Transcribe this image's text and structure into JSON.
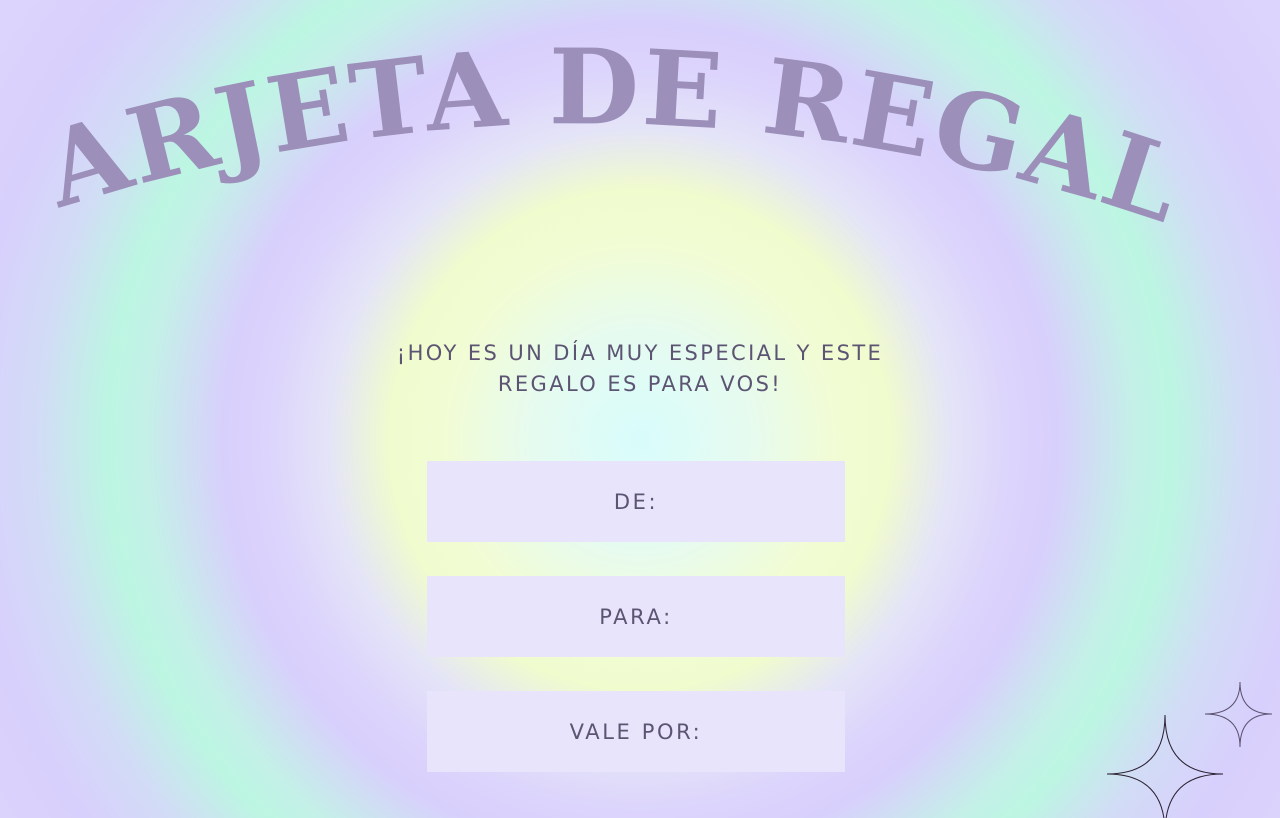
{
  "card": {
    "title": "TARJETA DE REGALO",
    "subtitle_line1": "¡HOY ES UN DÍA MUY ESPECIAL Y ESTE",
    "subtitle_line2": "REGALO ES PARA VOS!",
    "fields": {
      "from_label": "DE:",
      "to_label": "PARA:",
      "value_label": "VALE POR:"
    }
  },
  "colors": {
    "title": "#9c8fba",
    "text": "#5c5473",
    "field_background": "#e8e4fc",
    "gradient_center": "#d8fcfc",
    "gradient_yellow": "#f0fbce",
    "gradient_lavender": "#d8d0fc",
    "gradient_mint": "#bcf6e2"
  },
  "icons": [
    "large-sparkle-icon",
    "small-sparkle-icon"
  ]
}
